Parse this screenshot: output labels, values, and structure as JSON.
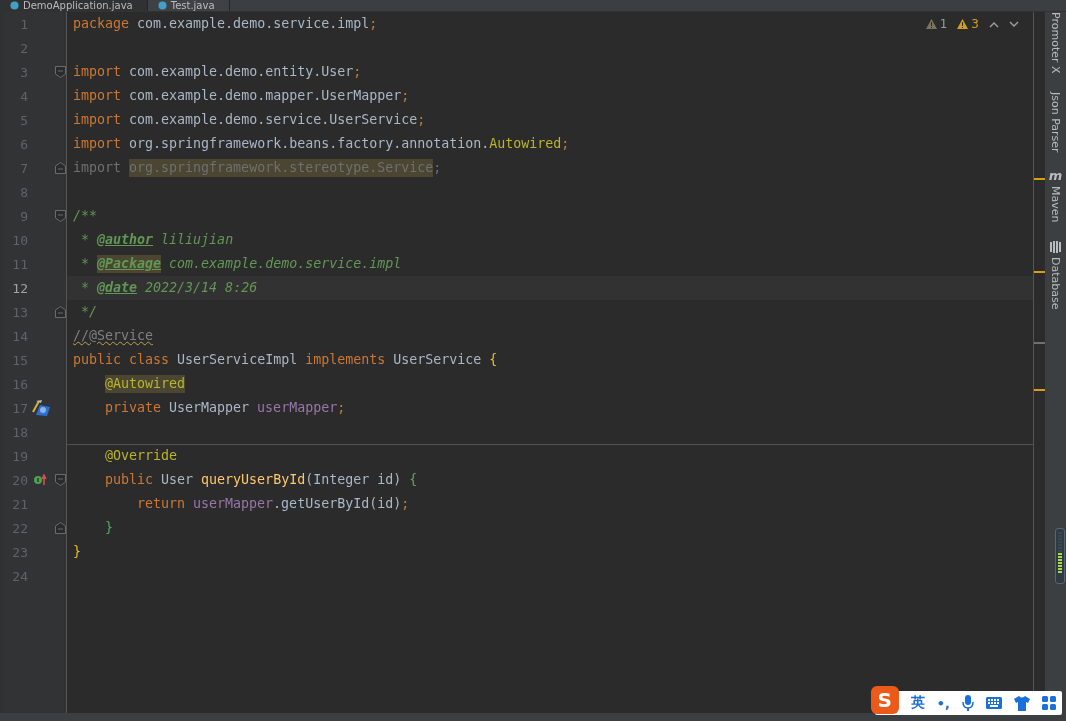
{
  "tabs": [
    {
      "label": "DemoApplication.java",
      "selected": false
    },
    {
      "label": "Test.java",
      "selected": true
    }
  ],
  "inspections": [
    {
      "kind": "weak",
      "count": "1"
    },
    {
      "kind": "warning",
      "count": "3"
    }
  ],
  "lines": [
    {
      "number": "1",
      "tokens": [
        {
          "kind": "keyword",
          "text": "package"
        },
        {
          "kind": "plain",
          "text": " com.example.demo.service.impl"
        },
        {
          "kind": "keyword",
          "text": ";"
        }
      ]
    },
    {
      "number": "2"
    },
    {
      "number": "3",
      "fold_start": true,
      "tokens": [
        {
          "kind": "keyword",
          "text": "import"
        },
        {
          "kind": "plain",
          "text": " com.example.demo.entity.User"
        },
        {
          "kind": "keyword",
          "text": ";"
        }
      ]
    },
    {
      "number": "4",
      "tokens": [
        {
          "kind": "keyword",
          "text": "import"
        },
        {
          "kind": "plain",
          "text": " com.example.demo.mapper.UserMapper"
        },
        {
          "kind": "keyword",
          "text": ";"
        }
      ]
    },
    {
      "number": "5",
      "tokens": [
        {
          "kind": "keyword",
          "text": "import"
        },
        {
          "kind": "plain",
          "text": " com.example.demo.service.UserService"
        },
        {
          "kind": "keyword",
          "text": ";"
        }
      ]
    },
    {
      "number": "6",
      "tokens": [
        {
          "kind": "keyword",
          "text": "import"
        },
        {
          "kind": "plain",
          "text": " org.springframework.beans.factory.annotation."
        },
        {
          "kind": "annotation",
          "text": "Autowired"
        },
        {
          "kind": "keyword",
          "text": ";"
        }
      ]
    },
    {
      "number": "7",
      "fold_end": true,
      "tokens": [
        {
          "kind": "unused",
          "text": "import "
        },
        {
          "kind": "unused",
          "text": "org.springframework.stereotype.Service",
          "highlight": true
        },
        {
          "kind": "unused",
          "text": ";"
        }
      ]
    },
    {
      "number": "8"
    },
    {
      "number": "9",
      "fold_start": true,
      "tokens": [
        {
          "kind": "doc",
          "text": "/**"
        }
      ]
    },
    {
      "number": "10",
      "tokens": [
        {
          "kind": "doc",
          "text": " * "
        },
        {
          "kind": "doctag",
          "text": "@author"
        },
        {
          "kind": "doc",
          "text": " liliujian"
        }
      ]
    },
    {
      "number": "11",
      "tokens": [
        {
          "kind": "doc",
          "text": " * "
        },
        {
          "kind": "doctag",
          "text": "@Package",
          "highlight": true
        },
        {
          "kind": "doc",
          "text": " com.example.demo.service.impl"
        }
      ]
    },
    {
      "number": "12",
      "current": true,
      "tokens": [
        {
          "kind": "doc",
          "text": " * "
        },
        {
          "kind": "doctag",
          "text": "@date"
        },
        {
          "kind": "doc",
          "text": " 2022/3/14 8:26"
        }
      ]
    },
    {
      "number": "13",
      "fold_end": true,
      "tokens": [
        {
          "kind": "doc",
          "text": " */"
        }
      ]
    },
    {
      "number": "14",
      "tokens": [
        {
          "kind": "comment",
          "text": "//@Service",
          "squiggle": true
        }
      ]
    },
    {
      "number": "15",
      "tokens": [
        {
          "kind": "keyword",
          "text": "public class "
        },
        {
          "kind": "plain",
          "text": "UserServiceImpl "
        },
        {
          "kind": "keyword",
          "text": "implements "
        },
        {
          "kind": "plain",
          "text": "UserService "
        },
        {
          "kind": "open-brace",
          "text": "{"
        }
      ]
    },
    {
      "number": "16",
      "tokens": [
        {
          "kind": "annotation",
          "text": "@Autowired",
          "highlight": true
        }
      ]
    },
    {
      "number": "17",
      "gutter_marker": {
        "kind": "bean"
      },
      "tokens": [
        {
          "kind": "keyword",
          "text": "private "
        },
        {
          "kind": "plain",
          "text": "UserMapper "
        },
        {
          "kind": "field",
          "text": "userMapper"
        },
        {
          "kind": "keyword",
          "text": ";"
        }
      ]
    },
    {
      "number": "18"
    },
    {
      "number": "19",
      "separator_above": true,
      "tokens": [
        {
          "kind": "annotation",
          "text": "@Override"
        }
      ]
    },
    {
      "number": "20",
      "gutter_marker": {
        "kind": "implements"
      },
      "fold_start": true,
      "tokens": [
        {
          "kind": "keyword",
          "text": "public "
        },
        {
          "kind": "plain",
          "text": "User "
        },
        {
          "kind": "method",
          "text": "queryUserById"
        },
        {
          "kind": "plain",
          "text": "(Integer id) "
        },
        {
          "kind": "open-brace",
          "text": "{"
        }
      ]
    },
    {
      "number": "21",
      "tokens": [
        {
          "kind": "keyword",
          "text": "return "
        },
        {
          "kind": "field",
          "text": "userMapper"
        },
        {
          "kind": "plain",
          "text": ".getUserById(id)"
        },
        {
          "kind": "keyword",
          "text": ";"
        }
      ]
    },
    {
      "number": "22",
      "fold_end": true,
      "tokens": [
        {
          "kind": "close-brace",
          "text": "}"
        }
      ]
    },
    {
      "number": "23",
      "tokens": [
        {
          "kind": "close-brace",
          "text": "}"
        }
      ]
    },
    {
      "number": "24"
    }
  ],
  "tool_windows": [
    {
      "kind": "plain",
      "label": "Promoter X"
    },
    {
      "kind": "plain",
      "label": "Json Parser"
    },
    {
      "kind": "maven",
      "icon_text": "m",
      "label": "Maven"
    },
    {
      "kind": "database",
      "label": "Database"
    }
  ],
  "ime_bar": {
    "logo": "S",
    "mode": "英",
    "punctuation": "•,"
  }
}
